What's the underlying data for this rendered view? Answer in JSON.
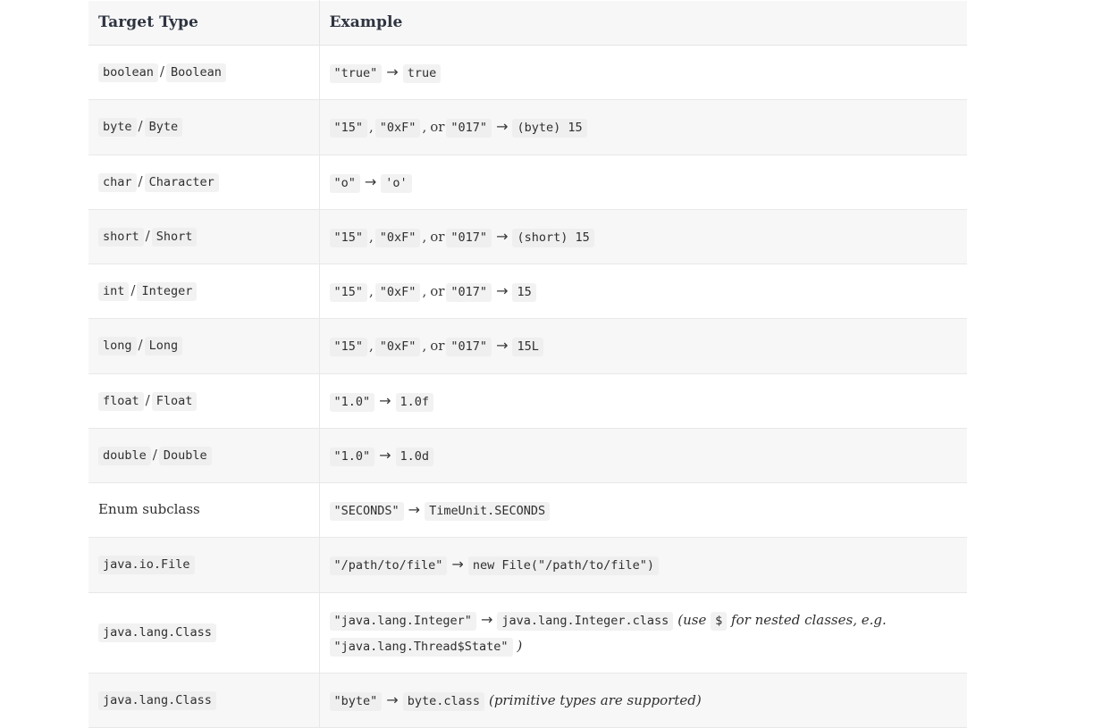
{
  "table": {
    "columns": [
      {
        "key": "target_type",
        "label": "Target Type"
      },
      {
        "key": "example",
        "label": "Example"
      }
    ],
    "arrow_glyph": "→",
    "slash_separator": "/",
    "comma_separator": ",",
    "or_separator": "or",
    "colors": {
      "header_background": "#f7f7f7",
      "stripe_background": "#f7f7f7",
      "row_background": "#ffffff",
      "code_background": "#f2f2f2",
      "border": "#e8e8e8",
      "header_text": "#2e3440",
      "body_text": "#2f2f2f"
    },
    "rows": [
      {
        "index": 0,
        "striped": false,
        "target_type_codes": [
          "boolean",
          "Boolean"
        ],
        "target_type_plain": "",
        "example_inputs": [
          "\"true\""
        ],
        "example_output": "true",
        "example_note": ""
      },
      {
        "index": 1,
        "striped": true,
        "target_type_codes": [
          "byte",
          "Byte"
        ],
        "target_type_plain": "",
        "example_inputs": [
          "\"15\"",
          "\"0xF\"",
          "\"017\""
        ],
        "example_output": "(byte) 15",
        "example_note": ""
      },
      {
        "index": 2,
        "striped": false,
        "target_type_codes": [
          "char",
          "Character"
        ],
        "target_type_plain": "",
        "example_inputs": [
          "\"o\""
        ],
        "example_output": "'o'",
        "example_note": ""
      },
      {
        "index": 3,
        "striped": true,
        "target_type_codes": [
          "short",
          "Short"
        ],
        "target_type_plain": "",
        "example_inputs": [
          "\"15\"",
          "\"0xF\"",
          "\"017\""
        ],
        "example_output": "(short) 15",
        "example_note": ""
      },
      {
        "index": 4,
        "striped": false,
        "target_type_codes": [
          "int",
          "Integer"
        ],
        "target_type_plain": "",
        "example_inputs": [
          "\"15\"",
          "\"0xF\"",
          "\"017\""
        ],
        "example_output": "15",
        "example_note": ""
      },
      {
        "index": 5,
        "striped": true,
        "target_type_codes": [
          "long",
          "Long"
        ],
        "target_type_plain": "",
        "example_inputs": [
          "\"15\"",
          "\"0xF\"",
          "\"017\""
        ],
        "example_output": "15L",
        "example_note": ""
      },
      {
        "index": 6,
        "striped": false,
        "target_type_codes": [
          "float",
          "Float"
        ],
        "target_type_plain": "",
        "example_inputs": [
          "\"1.0\""
        ],
        "example_output": "1.0f",
        "example_note": ""
      },
      {
        "index": 7,
        "striped": true,
        "target_type_codes": [
          "double",
          "Double"
        ],
        "target_type_plain": "",
        "example_inputs": [
          "\"1.0\""
        ],
        "example_output": "1.0d",
        "example_note": ""
      },
      {
        "index": 8,
        "striped": false,
        "target_type_codes": [],
        "target_type_plain": "Enum subclass",
        "example_inputs": [
          "\"SECONDS\""
        ],
        "example_output": "TimeUnit.SECONDS",
        "example_note": ""
      },
      {
        "index": 9,
        "striped": true,
        "target_type_codes": [
          "java.io.File"
        ],
        "target_type_plain": "",
        "example_inputs": [
          "\"/path/to/file\""
        ],
        "example_output": "new File(\"/path/to/file\")",
        "example_note": ""
      },
      {
        "index": 10,
        "striped": false,
        "target_type_codes": [
          "java.lang.Class"
        ],
        "target_type_plain": "",
        "example_inputs": [
          "\"java.lang.Integer\""
        ],
        "example_output": "java.lang.Integer.class",
        "example_note": {
          "prefix": "(use",
          "code": "$",
          "middle": "for nested classes, e.g.",
          "code2": "\"java.lang.Thread$State\"",
          "suffix": ")"
        }
      },
      {
        "index": 11,
        "striped": true,
        "target_type_codes": [
          "java.lang.Class"
        ],
        "target_type_plain": "",
        "example_inputs": [
          "\"byte\""
        ],
        "example_output": "byte.class",
        "example_note": "(primitive types are supported)"
      }
    ]
  }
}
